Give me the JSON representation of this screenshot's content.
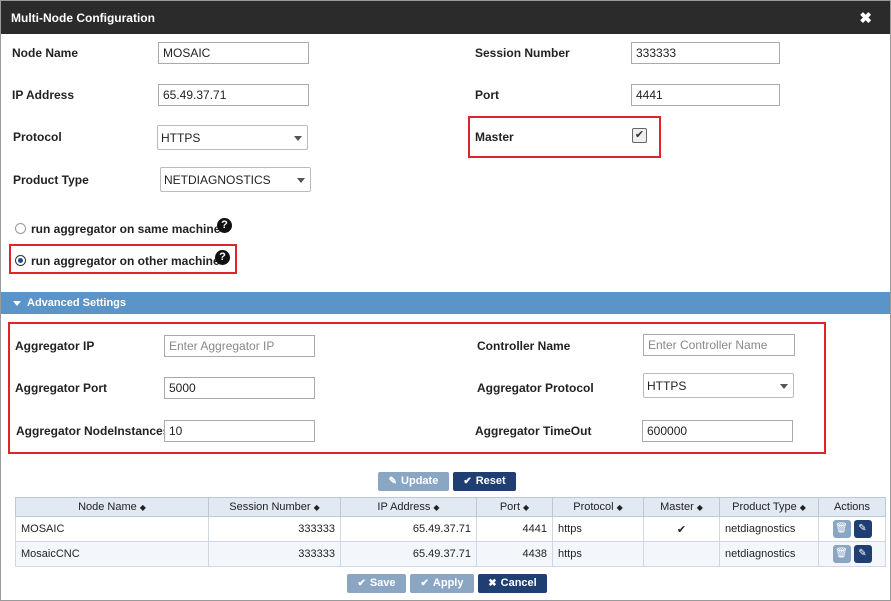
{
  "title": "Multi-Node Configuration",
  "close_icon": "close-icon",
  "node": {
    "node_name_label": "Node Name",
    "node_name_value": "MOSAIC",
    "session_number_label": "Session Number",
    "session_number_value": "333333",
    "ip_address_label": "IP Address",
    "ip_address_value": "65.49.37.71",
    "port_label": "Port",
    "port_value": "4441",
    "protocol_label": "Protocol",
    "protocol_value": "HTTPS",
    "master_label": "Master",
    "master_checked": true,
    "product_type_label": "Product Type",
    "product_type_value": "NETDIAGNOSTICS"
  },
  "aggregator_mode": {
    "same_label": "run aggregator on same machine",
    "other_label": "run aggregator on other machine",
    "selected": "other"
  },
  "advanced": {
    "header": "Advanced Settings",
    "aggregator_ip_label": "Aggregator IP",
    "aggregator_ip_placeholder": "Enter Aggregator IP",
    "controller_name_label": "Controller Name",
    "controller_name_placeholder": "Enter Controller Name",
    "aggregator_port_label": "Aggregator Port",
    "aggregator_port_value": "5000",
    "aggregator_protocol_label": "Aggregator Protocol",
    "aggregator_protocol_value": "HTTPS",
    "aggregator_nodeinstances_label": "Aggregator NodeInstances",
    "aggregator_nodeinstances_value": "10",
    "aggregator_timeout_label": "Aggregator TimeOut",
    "aggregator_timeout_value": "600000"
  },
  "buttons": {
    "update": "Update",
    "reset": "Reset",
    "save": "Save",
    "apply": "Apply",
    "cancel": "Cancel"
  },
  "table": {
    "headers": [
      "Node Name",
      "Session Number",
      "IP Address",
      "Port",
      "Protocol",
      "Master",
      "Product Type",
      "Actions"
    ],
    "rows": [
      {
        "node_name": "MOSAIC",
        "session_number": "333333",
        "ip_address": "65.49.37.71",
        "port": "4441",
        "protocol": "https",
        "master": "✔",
        "product_type": "netdiagnostics"
      },
      {
        "node_name": "MosaicCNC",
        "session_number": "333333",
        "ip_address": "65.49.37.71",
        "port": "4438",
        "protocol": "https",
        "master": "",
        "product_type": "netdiagnostics"
      }
    ]
  },
  "colors": {
    "titlebar": "#2b2b2b",
    "advanced_bar": "#5b94c9",
    "primary_button": "#1f3f73",
    "disabled_button": "#8aa6c3",
    "highlight_box": "#e0242a"
  }
}
